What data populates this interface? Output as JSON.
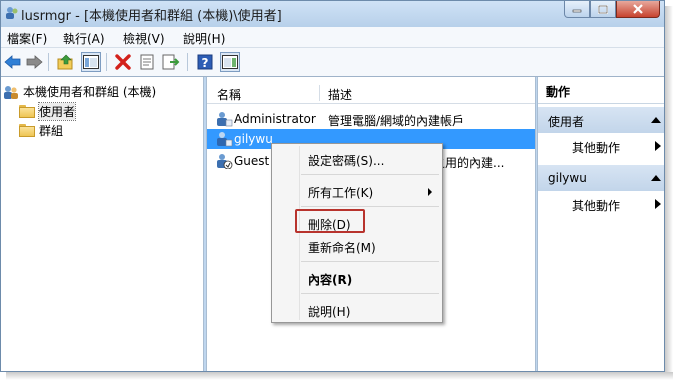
{
  "window": {
    "title": "lusrmgr - [本機使用者和群組 (本機)\\使用者]"
  },
  "menubar": {
    "items": [
      "檔案(F)",
      "執行(A)",
      "檢視(V)",
      "說明(H)"
    ]
  },
  "toolbar": {
    "icons": [
      "back-arrow-icon",
      "forward-arrow-icon",
      "up-folder-icon",
      "show-hide-tree-icon",
      "delete-x-icon",
      "properties-icon",
      "export-list-icon",
      "help-icon",
      "show-hide-action-pane-icon"
    ]
  },
  "tree": {
    "root": "本機使用者和群組 (本機)",
    "children": [
      "使用者",
      "群組"
    ]
  },
  "list": {
    "columns": {
      "name": "名稱",
      "description": "描述"
    },
    "rows": [
      {
        "name": "Administrator",
        "description": "管理電腦/網域的內建帳戶"
      },
      {
        "name": "gilywu",
        "description": ""
      },
      {
        "name": "Guest",
        "description": "之用的內建..."
      }
    ]
  },
  "context_menu": {
    "items": [
      "設定密碼(S)...",
      "所有工作(K)",
      "刪除(D)",
      "重新命名(M)",
      "內容(R)",
      "說明(H)"
    ]
  },
  "actions": {
    "title": "動作",
    "sections": [
      {
        "header": "使用者",
        "item": "其他動作"
      },
      {
        "header": "gilywu",
        "item": "其他動作"
      }
    ]
  },
  "colors": {
    "selection": "#3399ff",
    "highlight_box": "#b8332d",
    "titlebar": "#bfd6ee"
  }
}
